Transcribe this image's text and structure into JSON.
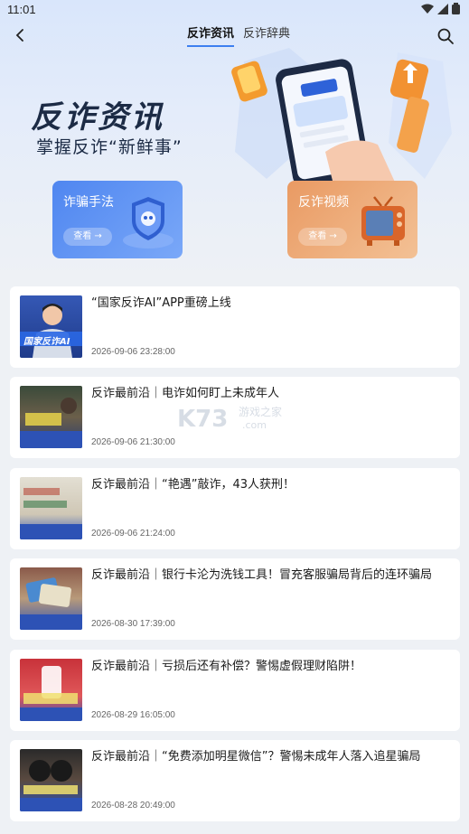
{
  "status_bar": {
    "time": "11:01"
  },
  "nav": {
    "tabs": [
      {
        "label": "反诈资讯",
        "active": true
      },
      {
        "label": "反诈辞典",
        "active": false
      }
    ]
  },
  "hero": {
    "title": "反诈资讯",
    "subtitle": "掌握反诈“新鲜事”",
    "cards": [
      {
        "label": "诈骗手法",
        "button": "查看 →",
        "color": "#5a8ff2"
      },
      {
        "label": "反诈视频",
        "button": "查看 →",
        "color": "#eba06c"
      }
    ]
  },
  "articles": [
    {
      "title": "“国家反诈AI”APP重磅上线",
      "date": "2026-09-06 23:28:00",
      "thumb_text": "国家反诈AI"
    },
    {
      "title": "反诈最前沿｜电诈如何盯上未成年人",
      "date": "2026-09-06 21:30:00",
      "thumb_text": ""
    },
    {
      "title": "反诈最前沿｜“艳遇”敲诈，43人获刑！",
      "date": "2026-09-06 21:24:00",
      "thumb_text": ""
    },
    {
      "title": "反诈最前沿｜银行卡沦为洗钱工具！冒充客服骗局背后的连环骗局",
      "date": "2026-08-30 17:39:00",
      "thumb_text": ""
    },
    {
      "title": "反诈最前沿｜亏损后还有补偿？警惕虚假理财陷阱！",
      "date": "2026-08-29 16:05:00",
      "thumb_text": ""
    },
    {
      "title": "反诈最前沿｜“免费添加明星微信”？警惕未成年人落入追星骗局",
      "date": "2026-08-28 20:49:00",
      "thumb_text": ""
    }
  ],
  "watermark": {
    "text": "K73",
    "sub": "游戏之家",
    "domain": ".com"
  },
  "colors": {
    "accent": "#3d7ff0",
    "background": "#eef1f5"
  }
}
